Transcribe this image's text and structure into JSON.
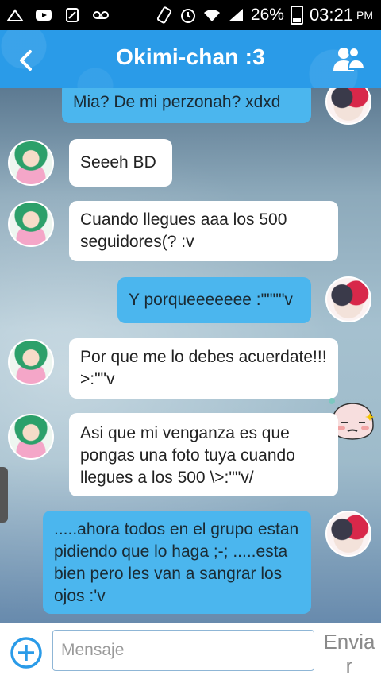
{
  "status_bar": {
    "battery": "26%",
    "time": "03:21",
    "ampm": "PM"
  },
  "header": {
    "title": "Okimi-chan :3"
  },
  "messages": [
    {
      "sender": "me",
      "text": "Mia? De mi perzonah? xdxd"
    },
    {
      "sender": "other",
      "text": "Seeeh BD"
    },
    {
      "sender": "other",
      "text": "Cuando llegues aaa los 500 seguidores(? :v"
    },
    {
      "sender": "me",
      "text": "Y porqueeeeeee :\"\"\"\"v"
    },
    {
      "sender": "other",
      "text": "Por que me lo debes acuerdate!!! >:\"\"v"
    },
    {
      "sender": "other",
      "text": "Asi que mi venganza es que pongas una foto tuya cuando llegues a los 500 \\>:\"\"v/"
    },
    {
      "sender": "me",
      "text": ".....ahora todos en el grupo estan pidiendo que lo haga ;-; .....esta bien pero les van a sangrar los ojos :'v"
    }
  ],
  "input": {
    "placeholder": "Mensaje",
    "send_label": "Enviar"
  },
  "colors": {
    "accent": "#2a9be8",
    "my_bubble": "#4bb6ee",
    "other_bubble": "#ffffff"
  },
  "icons": [
    "back-icon",
    "group-icon",
    "add-icon",
    "sticker-face-icon"
  ]
}
